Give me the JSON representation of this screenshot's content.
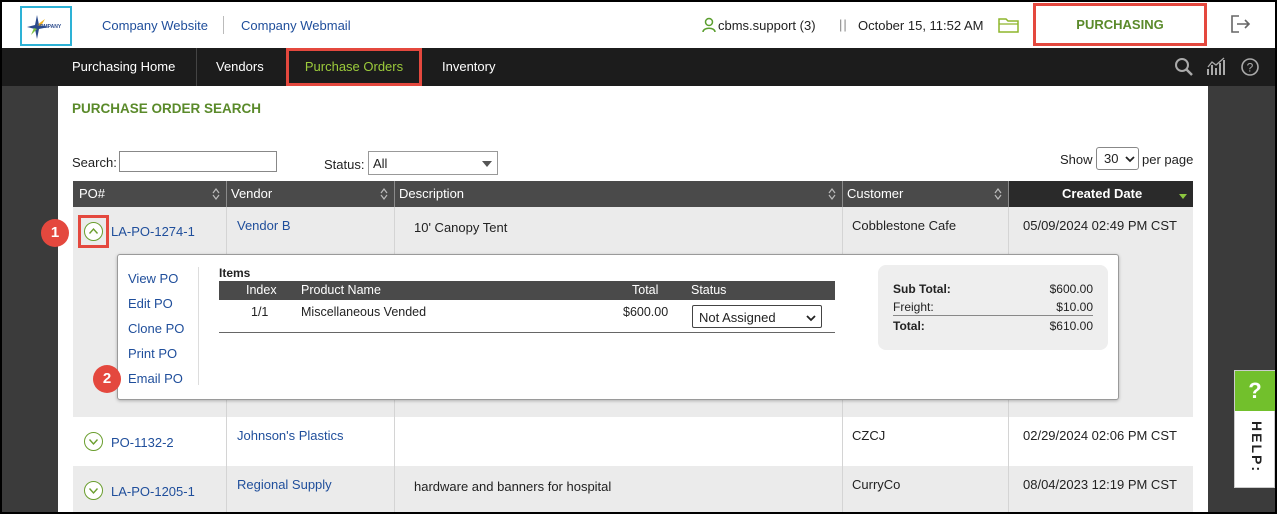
{
  "header": {
    "logo_text": "COMPANY",
    "links": [
      "Company Website",
      "Company Webmail"
    ],
    "user": "cbms.support (3)",
    "separator": "||",
    "datetime": "October 15, 11:52 AM",
    "module": "PURCHASING"
  },
  "nav": {
    "items": [
      "Purchasing Home",
      "Vendors",
      "Purchase Orders",
      "Inventory"
    ],
    "active": "Purchase Orders"
  },
  "page": {
    "title": "PURCHASE ORDER SEARCH",
    "search_label": "Search:",
    "search_value": "",
    "status_label": "Status:",
    "status_value": "All",
    "show_label": "Show",
    "show_value": "30",
    "per_page_label": "per page"
  },
  "table": {
    "columns": [
      "PO#",
      "Vendor",
      "Description",
      "Customer",
      "Created Date"
    ],
    "rows": [
      {
        "po": "LA-PO-1274-1",
        "vendor": "Vendor B",
        "description": "10' Canopy Tent",
        "customer": "Cobblestone Cafe",
        "created": "05/09/2024 02:49 PM CST"
      },
      {
        "po": "PO-1132-2",
        "vendor": "Johnson's Plastics",
        "description": "",
        "customer": "CZCJ",
        "created": "02/29/2024 02:06 PM CST"
      },
      {
        "po": "LA-PO-1205-1",
        "vendor": "Regional Supply",
        "description": "hardware and banners for hospital",
        "customer": "CurryCo",
        "created": "08/04/2023 12:19 PM CST"
      }
    ]
  },
  "detail": {
    "actions": [
      "View PO",
      "Edit PO",
      "Clone PO",
      "Print PO",
      "Email PO"
    ],
    "items_title": "Items",
    "item_columns": [
      "Index",
      "Product Name",
      "Total",
      "Status"
    ],
    "item": {
      "index": "1/1",
      "product": "Miscellaneous Vended",
      "total": "$600.00",
      "status": "Not Assigned"
    },
    "totals": {
      "subtotal_label": "Sub Total:",
      "subtotal": "$600.00",
      "freight_label": "Freight:",
      "freight": "$10.00",
      "total_label": "Total:",
      "total": "$610.00"
    }
  },
  "annotations": {
    "badge1": "1",
    "badge2": "2"
  },
  "help": {
    "q": "?",
    "label": "HELP:"
  },
  "colors": {
    "accent_green": "#5a8a2a",
    "highlight_red": "#e4483e",
    "link_blue": "#1f4e9b",
    "nav_bg": "#1c1c1c"
  }
}
